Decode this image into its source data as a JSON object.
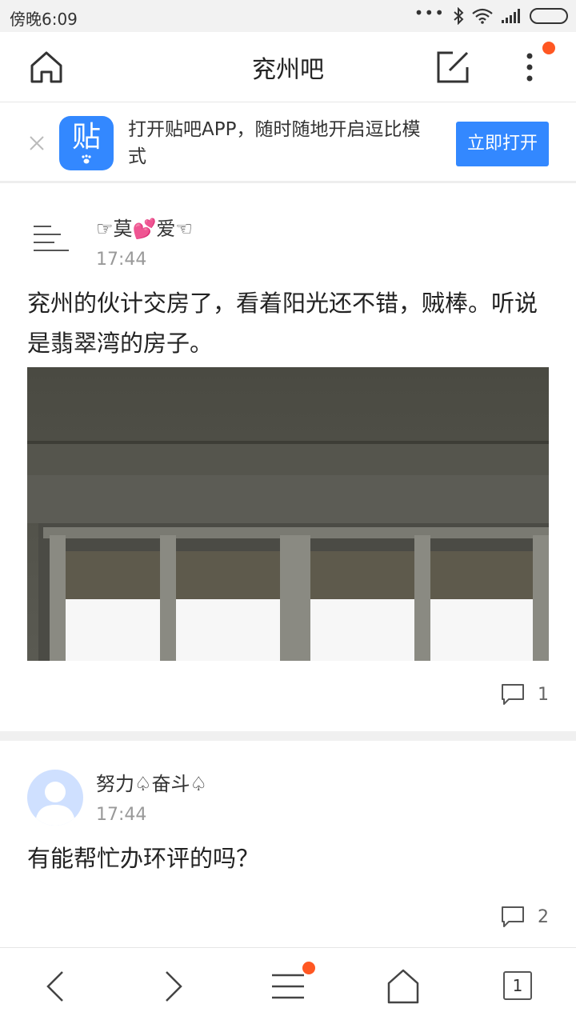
{
  "status_bar": {
    "time": "傍晚6:09"
  },
  "header": {
    "title": "兖州吧"
  },
  "banner": {
    "text": "打开贴吧APP，随时随地开启逗比模式",
    "app_icon_glyph": "贴",
    "open_button": "立即打开"
  },
  "posts": [
    {
      "username": "☞莫💕爱☜",
      "time": "17:44",
      "text": "兖州的伙计交房了，看着阳光还不错，贼棒。听说是翡翠湾的房子。",
      "comment_count": "1"
    },
    {
      "username": "努力♤奋斗♤",
      "time": "17:44",
      "text": "有能帮忙办环评的吗？",
      "comment_count": "2"
    }
  ],
  "bottom_nav": {
    "tab_count": "1"
  },
  "colors": {
    "accent": "#3388ff",
    "notification": "#ff5722",
    "muted_text": "#999999",
    "status_bar_bg": "#f2f2f2"
  }
}
